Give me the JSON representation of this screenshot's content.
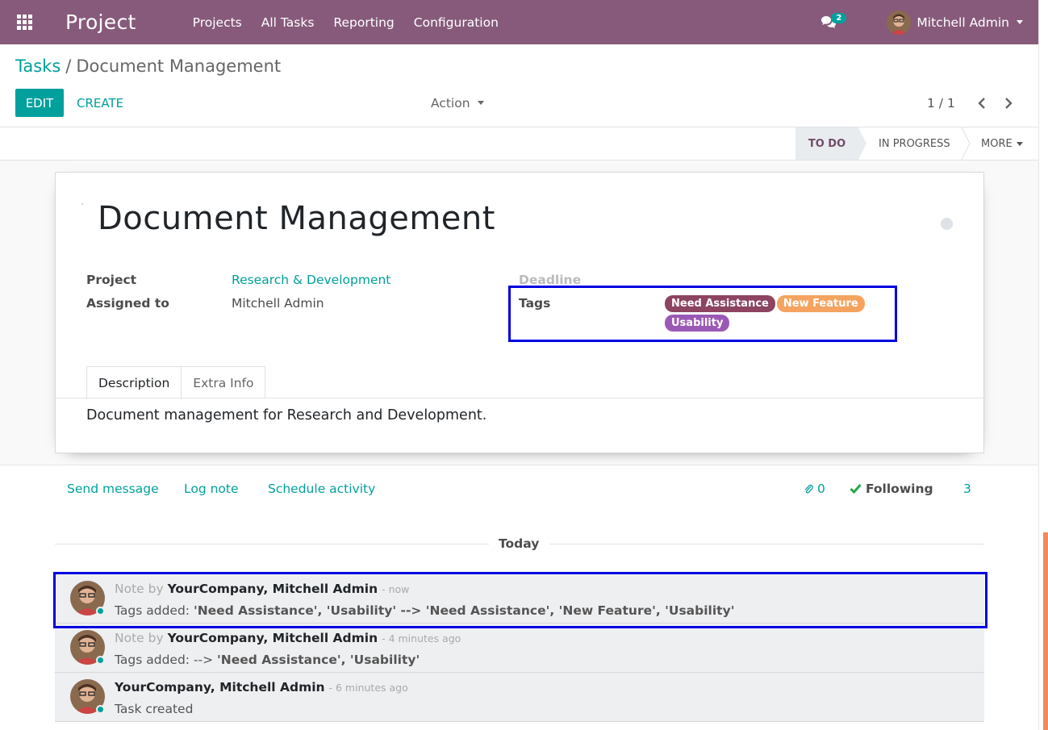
{
  "navbar": {
    "brand": "Project",
    "menu": [
      "Projects",
      "All Tasks",
      "Reporting",
      "Configuration"
    ],
    "messages_count": "2",
    "user_name": "Mitchell Admin"
  },
  "breadcrumb": {
    "parent": "Tasks",
    "separator": "/",
    "current": "Document Management"
  },
  "toolbar": {
    "edit_label": "EDIT",
    "create_label": "CREATE",
    "action_label": "Action",
    "pager": "1 / 1"
  },
  "statusbar": {
    "stages": [
      "TO DO",
      "IN PROGRESS"
    ],
    "more_label": "MORE"
  },
  "task": {
    "title": "Document Management",
    "fields": {
      "project_label": "Project",
      "project_value": "Research & Development",
      "assigned_label": "Assigned to",
      "assigned_value": "Mitchell Admin",
      "deadline_label": "Deadline",
      "tags_label": "Tags"
    },
    "tags": [
      {
        "name": "Need Assistance",
        "color": "#8c4461"
      },
      {
        "name": "New Feature",
        "color": "#f4a460"
      },
      {
        "name": "Usability",
        "color": "#9b59b6"
      }
    ],
    "tabs": [
      "Description",
      "Extra Info"
    ],
    "description": "Document management for Research and  Development."
  },
  "chatter": {
    "send_message": "Send message",
    "log_note": "Log note",
    "schedule_activity": "Schedule activity",
    "attachments_count": "0",
    "following_label": "Following",
    "followers_count": "3",
    "date_separator": "Today",
    "messages": [
      {
        "prefix": "Note by",
        "author": "YourCompany, Mitchell Admin",
        "time": "- now",
        "body_text": "Tags added: ",
        "body_bold": "'Need Assistance', 'Usability' --> 'Need Assistance', 'New Feature', 'Usability'"
      },
      {
        "prefix": "Note by",
        "author": "YourCompany, Mitchell Admin",
        "time": "- 4 minutes ago",
        "body_text": "Tags added: --> ",
        "body_bold": "'Need Assistance', 'Usability'"
      },
      {
        "prefix": "",
        "author": "YourCompany, Mitchell Admin",
        "time": "- 6 minutes ago",
        "body_text": "Task created",
        "body_bold": ""
      }
    ]
  },
  "colors": {
    "navbar": "#875a7b",
    "primary": "#00a09d",
    "highlight": "#0000e0"
  },
  "icons": [
    "apps-grid-icon",
    "chat-icon",
    "chevron-left-icon",
    "chevron-right-icon",
    "paperclip-icon",
    "check-icon"
  ]
}
